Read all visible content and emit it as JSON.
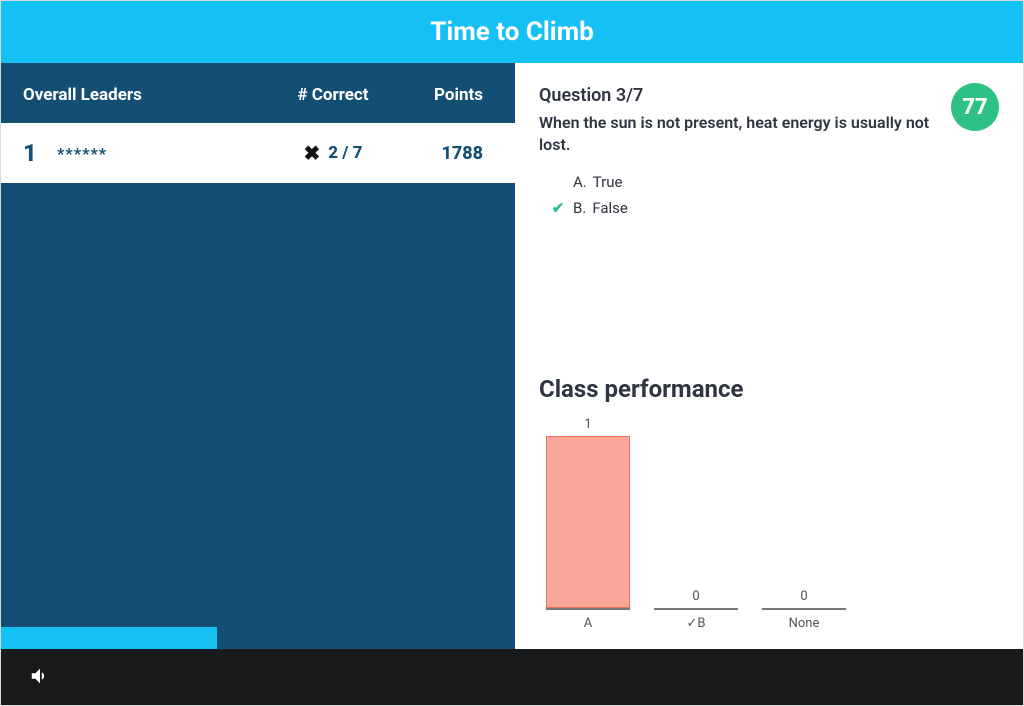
{
  "header": {
    "title": "Time to Climb"
  },
  "leaders": {
    "title": "Overall Leaders",
    "col_correct": "# Correct",
    "col_points": "Points",
    "rows": [
      {
        "rank": "1",
        "name": "******",
        "correct_icon": "✖",
        "correct": "2 / 7",
        "points": "1788"
      }
    ],
    "progress_pct": 42
  },
  "question": {
    "number_label": "Question 3/7",
    "text": "When the sun is not present, heat energy is usually not lost.",
    "answers": [
      {
        "letter": "A.",
        "text": "True",
        "correct": false
      },
      {
        "letter": "B.",
        "text": "False",
        "correct": true
      }
    ],
    "score_badge": "77"
  },
  "performance": {
    "title": "Class performance"
  },
  "chart_data": {
    "type": "bar",
    "title": "Class performance",
    "categories": [
      "A",
      "✓B",
      "None"
    ],
    "values": [
      1,
      0,
      0
    ],
    "xlabel": "",
    "ylabel": "",
    "ylim": [
      0,
      1
    ]
  },
  "colors": {
    "brand_blue": "#14c0f4",
    "panel_navy": "#134e73",
    "accent_green": "#2ec184",
    "bar_wrong": "#f8a79a"
  }
}
